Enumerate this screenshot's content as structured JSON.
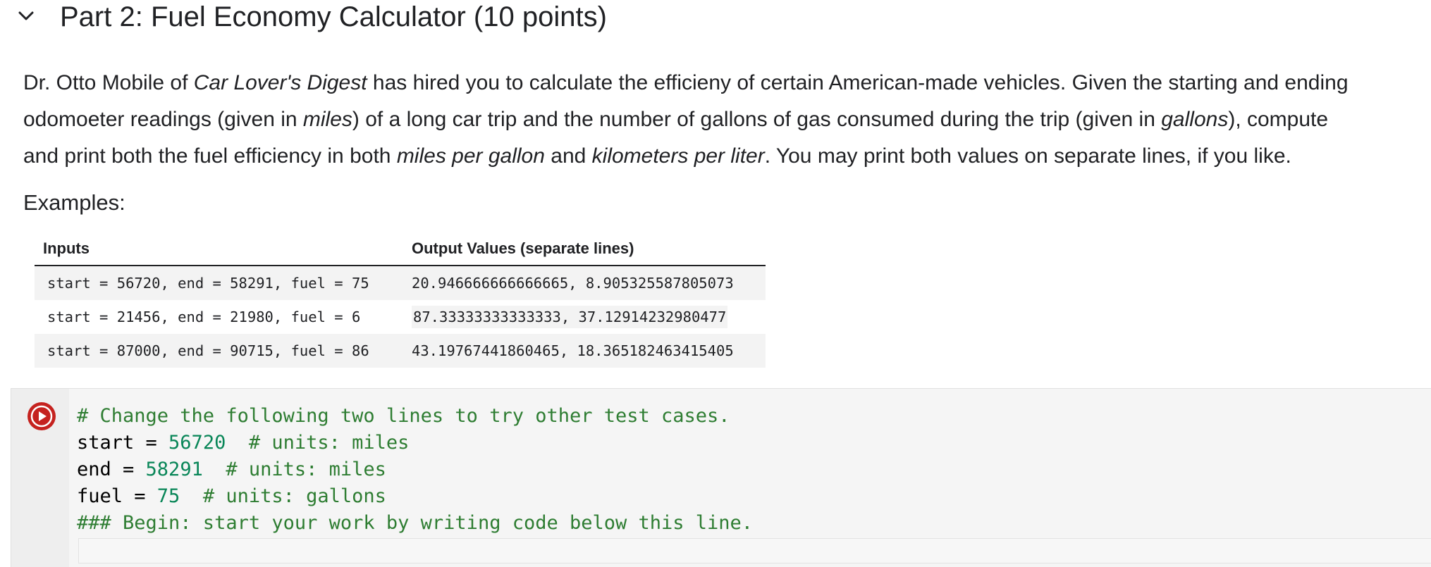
{
  "header": {
    "title": "Part 2: Fuel Economy Calculator (10 points)"
  },
  "paragraph": {
    "line1_a": "Dr. Otto Mobile of ",
    "line1_em": "Car Lover's Digest",
    "line1_b": " has hired you to calculate the efficieny of certain American-made vehicles. Given the starting and ending",
    "line2_a": "odomoeter readings (given in ",
    "line2_em1": "miles",
    "line2_b": ") of a long car trip and the number of gallons of gas consumed during the trip (given in ",
    "line2_em2": "gallons",
    "line2_c": "), compute",
    "line3_a": "and print both the fuel efficiency in both ",
    "line3_em1": "miles per gallon",
    "line3_b": " and ",
    "line3_em2": "kilometers per liter",
    "line3_c": ". You may print both values on separate lines, if you like."
  },
  "examples_label": "Examples:",
  "table": {
    "headers": [
      "Inputs",
      "Output Values (separate lines)"
    ],
    "rows": [
      {
        "input": "start = 56720, end = 58291, fuel = 75",
        "output": "20.946666666666665, 8.905325587805073"
      },
      {
        "input": "start = 21456, end = 21980, fuel = 6",
        "output": "87.33333333333333, 37.12914232980477"
      },
      {
        "input": "start = 87000, end = 90715, fuel = 86",
        "output": "43.19767441860465, 18.365182463415405"
      }
    ]
  },
  "code": {
    "line1_comment": "# Change the following two lines to try other test cases.",
    "line2_var": "start = ",
    "line2_num": "56720",
    "line2_comment": "  # units: miles",
    "line3_var": "end = ",
    "line3_num": "58291",
    "line3_comment": "  # units: miles",
    "line4_var": "fuel = ",
    "line4_num": "75",
    "line4_comment": "  # units: gallons",
    "line5_comment": "### Begin: start your work by writing code below this line."
  },
  "icons": {
    "collapse": "chevron-down-icon",
    "run": "play-icon"
  },
  "colors": {
    "run_button": "#c5221f",
    "comment": "#2e7d32",
    "number": "#098658"
  }
}
